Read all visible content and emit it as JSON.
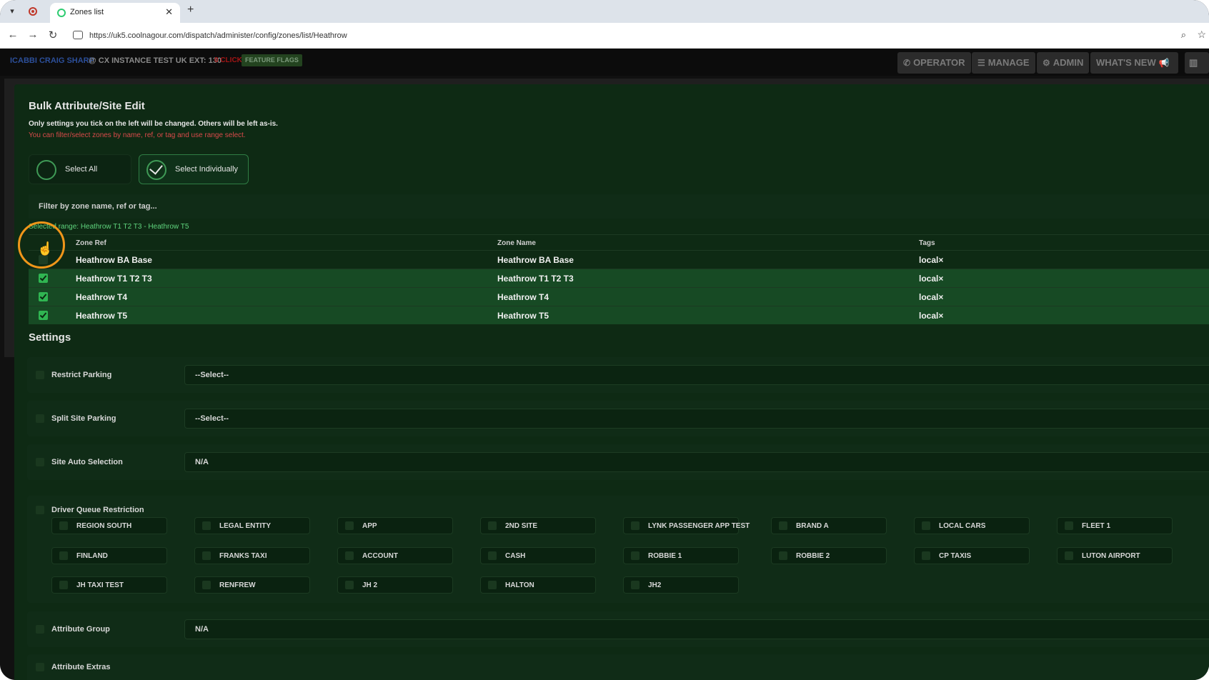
{
  "browser": {
    "tab_title": "Zones list",
    "url": "https://uk5.coolnagour.com/dispatch/administer/config/zones/list/Heathrow"
  },
  "header": {
    "user": "ICABBI CRAIG SHARP",
    "instance": "@ CX INSTANCE TEST UK EXT: 130",
    "red_label": "0 CLICK",
    "feature_flags": "FEATURE FLAGS",
    "nav": [
      {
        "label": "OPERATOR",
        "icon": "phone-icon"
      },
      {
        "label": "MANAGE",
        "icon": "list-icon"
      },
      {
        "label": "ADMIN",
        "icon": "gear-icon"
      },
      {
        "label": "WHAT'S NEW",
        "icon": "megaphone-icon"
      }
    ]
  },
  "modal": {
    "title": "Bulk Attribute/Site Edit",
    "note": "Only settings you tick on the left will be changed. Others will be left as-is.",
    "hint": "You can filter/select zones by name, ref, or tag and use range select.",
    "select_all": "Select All",
    "select_individually": "Select Individually",
    "filter_placeholder": "Filter by zone name, ref or tag...",
    "selected_range": "Selected range: Heathrow T1 T2 T3 - Heathrow T5"
  },
  "table": {
    "columns": [
      "Zone Ref",
      "Zone Name",
      "Tags"
    ],
    "rows": [
      {
        "ref": "Heathrow BA Base",
        "name": "Heathrow BA Base",
        "tags": "local×",
        "checked": false
      },
      {
        "ref": "Heathrow T1 T2 T3",
        "name": "Heathrow T1 T2 T3",
        "tags": "local×",
        "checked": true
      },
      {
        "ref": "Heathrow T4",
        "name": "Heathrow T4",
        "tags": "local×",
        "checked": true
      },
      {
        "ref": "Heathrow T5",
        "name": "Heathrow T5",
        "tags": "local×",
        "checked": true
      }
    ]
  },
  "settings": {
    "title": "Settings",
    "restrict_parking": {
      "label": "Restrict Parking",
      "value": "--Select--"
    },
    "split_site_parking": {
      "label": "Split Site Parking",
      "value": "--Select--"
    },
    "site_auto_selection": {
      "label": "Site Auto Selection",
      "value": "N/A"
    },
    "driver_queue_restriction": {
      "label": "Driver Queue Restriction",
      "options": [
        [
          "REGION SOUTH",
          "LEGAL ENTITY",
          "APP",
          "2ND SITE",
          "LYNK PASSENGER APP TEST",
          "BRAND A",
          "LOCAL CARS",
          "FLEET 1"
        ],
        [
          "FINLAND",
          "FRANKS TAXI",
          "ACCOUNT",
          "CASH",
          "ROBBIE 1",
          "ROBBIE 2",
          "CP TAXIS",
          "LUTON AIRPORT"
        ],
        [
          "JH TAXI TEST",
          "RENFREW",
          "JH 2",
          "HALTON",
          "JH2"
        ]
      ]
    },
    "attribute_group": {
      "label": "Attribute Group",
      "value": "N/A"
    },
    "attribute_extras": {
      "label": "Attribute Extras"
    }
  }
}
